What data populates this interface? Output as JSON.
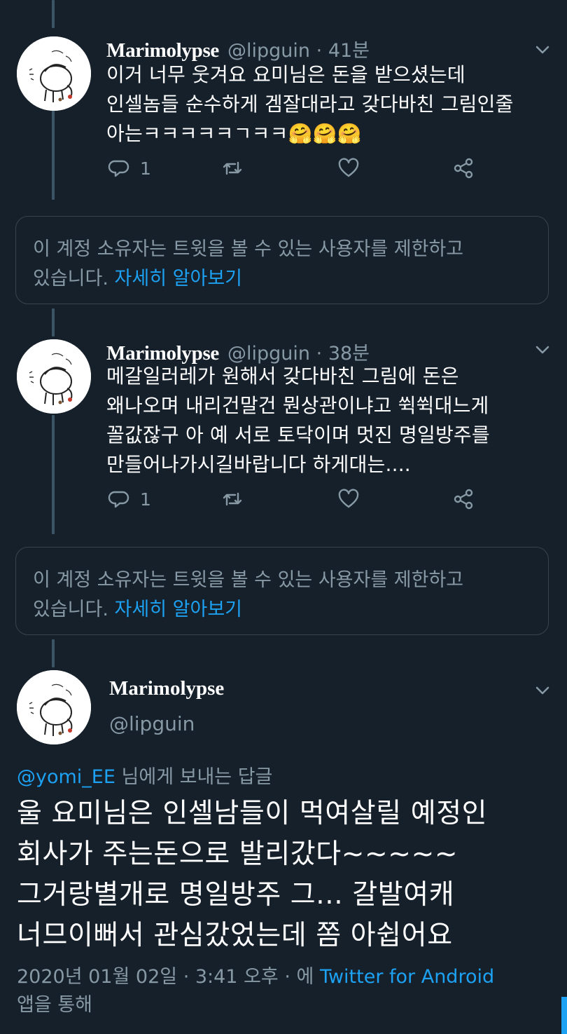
{
  "tweets": [
    {
      "display_name": "Marimolypse",
      "handle": "@lipguin",
      "separator": "·",
      "time": "41분",
      "text": "이거 너무 웃겨요 요미님은 돈을 받으셨는데\n인셀놈들 순수하게 겜잘대라고 갖다바친 그림인줄\n아는ㅋㅋㅋㅋㅋㄱㅋㅋ🤗🤗🤗",
      "reply_count": "1"
    },
    {
      "display_name": "Marimolypse",
      "handle": "@lipguin",
      "separator": "·",
      "time": "38분",
      "text": "메갈일러레가 원해서 갖다바친 그림에 돈은\n왜나오며 내리건말건 뭔상관이냐고 쒹쒹대느게\n꼴값잖구 아 예 서로 토닥이며 멋진 명일방주를\n만들어나가시길바랍니다 하게대는....",
      "reply_count": "1"
    }
  ],
  "notices": [
    {
      "text": "이 계정 소유자는 트윗을 볼 수 있는 사용자를 제한하고\n있습니다.",
      "link": "자세히 알아보기"
    },
    {
      "text": "이 계정 소유자는 트윗을 볼 수 있는 사용자를 제한하고\n있습니다.",
      "link": "자세히 알아보기"
    }
  ],
  "main_tweet": {
    "display_name": "Marimolypse",
    "handle": "@lipguin",
    "reply_mention": "@yomi_EE",
    "reply_suffix": "님에게 보내는 답글",
    "text": "울 요미님은 인셀남들이 먹여살릴 예정인\n회사가 주는돈으로 발리갔다~~~~~\n그거랑별개로 명일방주 그... 갈발여캐\n너므이뻐서 관심갔었는데 쫌 아쉽어요",
    "date": "2020년 01월 02일 · 3:41 오후 · 에",
    "source": "Twitter for Android",
    "via": "앱을 통해"
  },
  "icons": {
    "reply": "reply-icon",
    "retweet": "retweet-icon",
    "like": "heart-icon",
    "share": "share-icon",
    "more": "chevron-down-icon"
  },
  "colors": {
    "background": "#15202b",
    "secondary_text": "#8899a6",
    "link": "#1da1f2",
    "border": "#38444d"
  }
}
